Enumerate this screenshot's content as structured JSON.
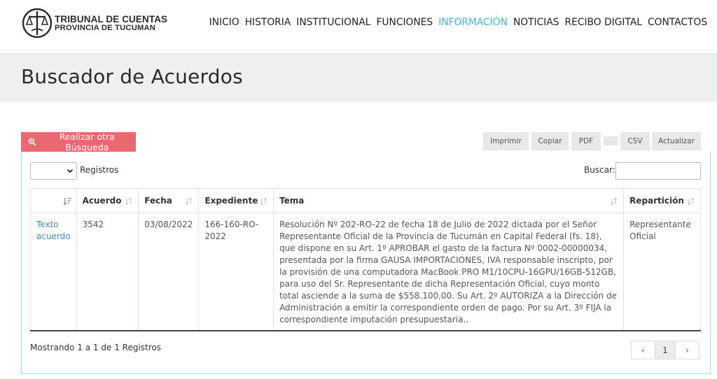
{
  "brand": {
    "line1": "TRIBUNAL DE CUENTAS",
    "line2": "PROVINCIA DE TUCUMAN"
  },
  "nav": [
    {
      "label": "INICIO"
    },
    {
      "label": "HISTORIA"
    },
    {
      "label": "INSTITUCIONAL"
    },
    {
      "label": "FUNCIONES"
    },
    {
      "label": "INFORMACIÓN",
      "active": true
    },
    {
      "label": "NOTICIAS"
    },
    {
      "label": "RECIBO DIGITAL"
    },
    {
      "label": "CONTACTOS"
    }
  ],
  "page": {
    "title": "Buscador de Acuerdos"
  },
  "actions": {
    "search_again": "Realizar otra Búsqueda",
    "print": "Imprimir",
    "copy": "Copiar",
    "pdf": "PDF",
    "csv": "CSV",
    "refresh": "Actualizar"
  },
  "controls": {
    "length_label": "Registros",
    "length_value": "",
    "search_label": "Buscar:",
    "search_value": ""
  },
  "table": {
    "headers": [
      "",
      "Acuerdo",
      "Fecha",
      "Expediente",
      "Tema",
      "Repartición"
    ],
    "rows": [
      {
        "link": "Texto acuerdo",
        "acuerdo": "3542",
        "fecha": "03/08/2022",
        "expediente": "166-160-RO-2022",
        "tema": "Resolución Nº 202-RO-22 de fecha 18 de Julio de 2022 dictada por el Señor Representante Oficial de la Provincia de Tucumán en Capital Federal (fs. 18), que dispone en su Art. 1º APROBAR el gasto de la factura Nº 0002-00000034, presentada por la firma GAUSA IMPORTACIONES, IVA responsable inscripto, por la provisión de una computadora MacBook PRO M1/10CPU-16GPU/16GB-512GB, para uso del Sr. Representante de dicha Representación Oficial, cuyo monto total asciende a la suma de $558.100,00. Su Art. 2º AUTORIZA a la Dirección de Administración a emitir la correspondiente orden de pago. Por su Art. 3º FIJA la correspondiente imputación presupuestaria..",
        "reparticion": "Representante Oficial"
      }
    ]
  },
  "footer": {
    "info": "Mostrando 1 a 1 de 1 Registros",
    "prev": "‹",
    "page": "1",
    "next": "›"
  },
  "colors": {
    "accent": "#41b8d0",
    "danger": "#e8696f",
    "link": "#3a8fc6",
    "band": "#eef0ef"
  }
}
